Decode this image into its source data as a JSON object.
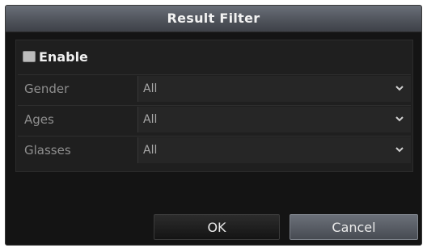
{
  "dialog": {
    "title": "Result Filter"
  },
  "enable": {
    "label": "Enable",
    "checked": false
  },
  "filters": [
    {
      "label": "Gender",
      "value": "All"
    },
    {
      "label": "Ages",
      "value": "All"
    },
    {
      "label": "Glasses",
      "value": "All"
    }
  ],
  "buttons": {
    "ok": "OK",
    "cancel": "Cancel"
  },
  "icons": {
    "dropdown": "chevron-down-icon"
  },
  "colors": {
    "background": "#141414",
    "title_bar": "#55595f",
    "selected_button": "#5c6068"
  }
}
